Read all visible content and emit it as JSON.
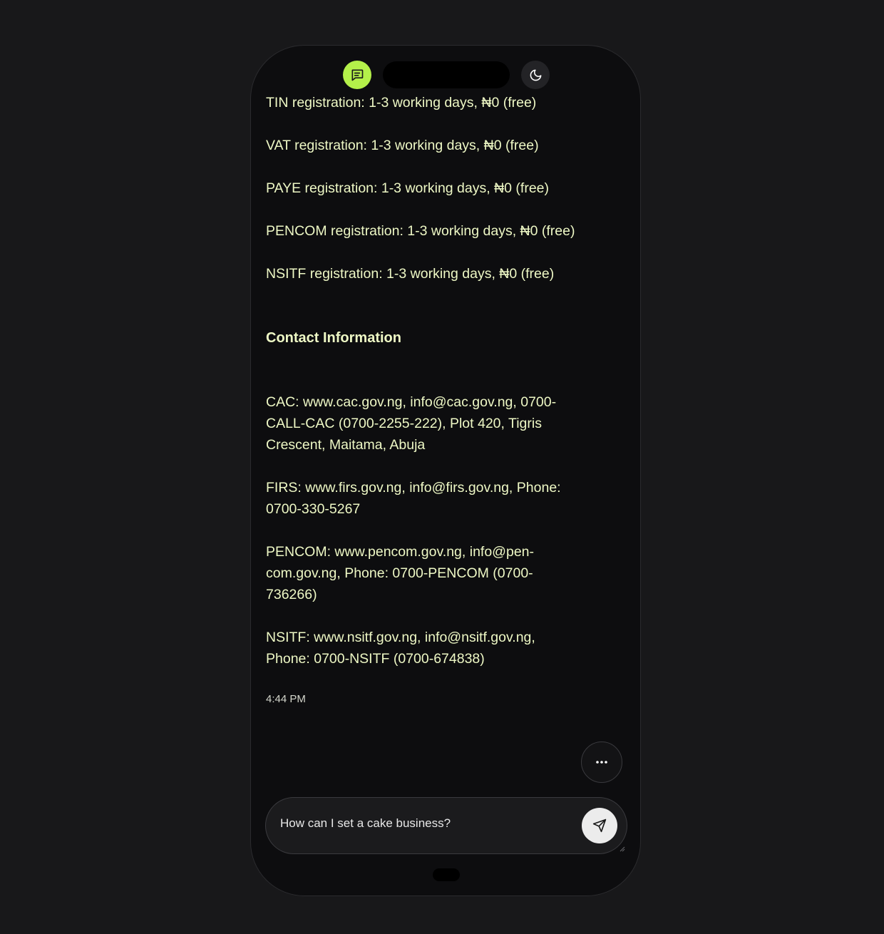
{
  "header": {
    "chat_icon": "chat-bubble-icon",
    "theme_icon": "moon-icon",
    "accent_color": "#b4f04a"
  },
  "messages": {
    "registration_lines": [
      "TIN registration: 1-3 working days, ₦0 (free)",
      "VAT registration: 1-3 working days, ₦0 (free)",
      "PAYE registration: 1-3 working days, ₦0 (free)",
      "PENCOM registration: 1-3 working days, ₦0 (free)",
      "NSITF registration: 1-3 working days, ₦0 (free)"
    ],
    "contact_heading": "Contact Information",
    "contact_lines": [
      "CAC: www.cac.gov.ng, info@cac.gov.ng, 0700-CALL-CAC (0700-2255-222), Plot 420, Tigris Crescent, Maitama, Abuja",
      "FIRS: www.firs.gov.ng, info@firs.gov.ng, Phone: 0700-330-5267",
      "PENCOM: www.pencom.gov.ng, info@pen-com.gov.ng, Phone: 0700-PENCOM (0700-736266)",
      "NSITF: www.nsitf.gov.ng, info@nsitf.gov.ng, Phone: 0700-NSITF (0700-674838)"
    ],
    "timestamp": "4:44 PM"
  },
  "actions": {
    "more_icon": "ellipsis-icon"
  },
  "composer": {
    "value": "How can I set a cake business?",
    "send_icon": "send-icon"
  }
}
